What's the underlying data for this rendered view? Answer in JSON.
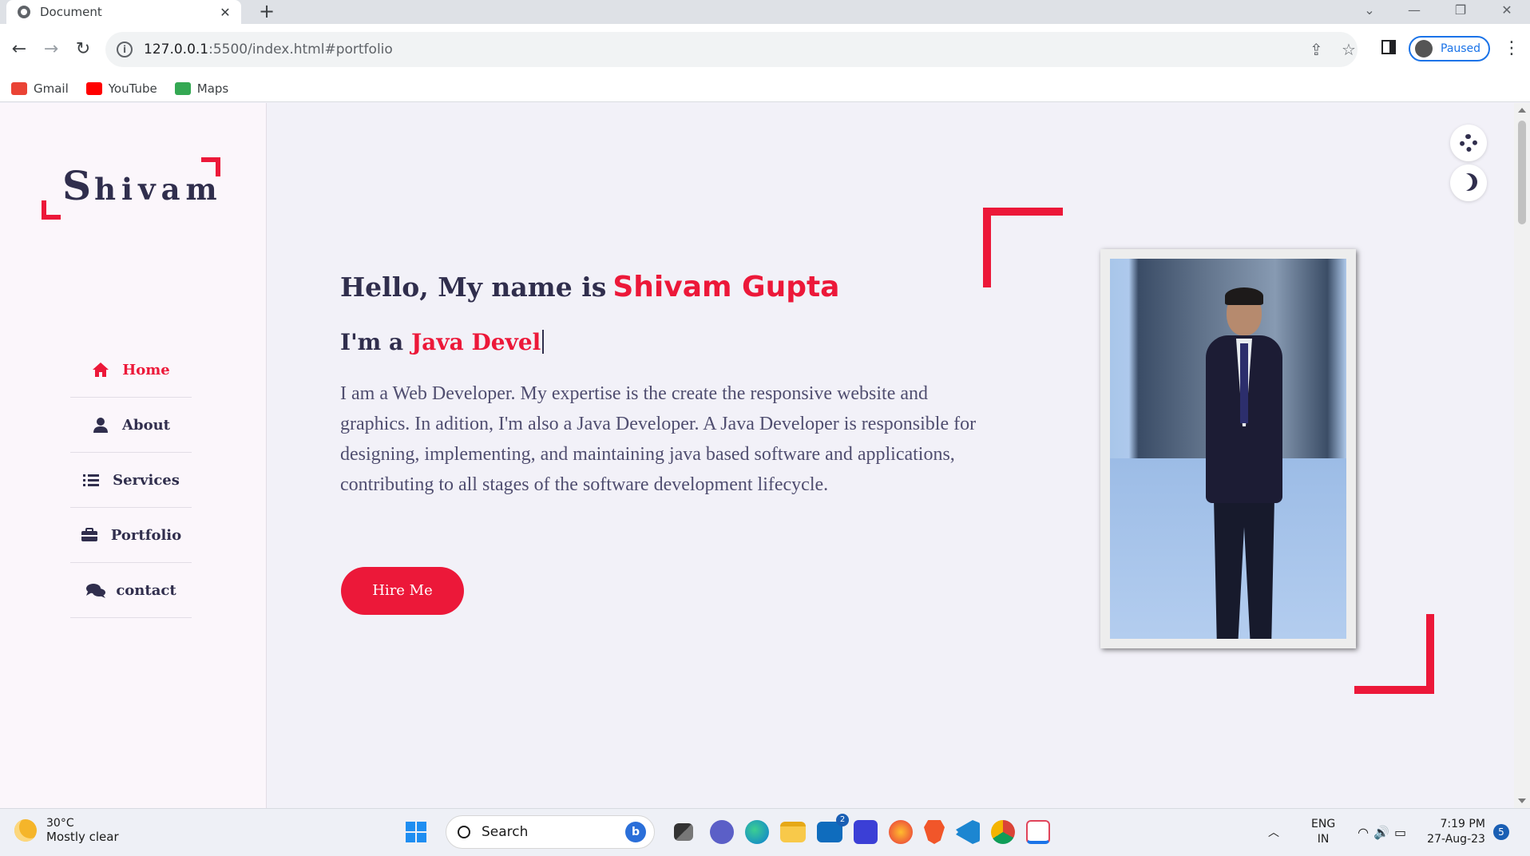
{
  "browser": {
    "tab_title": "Document",
    "tab_close": "✕",
    "new_tab": "+",
    "url_host": "127.0.0.1",
    "url_rest": ":5500/index.html#portfolio",
    "profile_status": "Paused",
    "bookmarks": [
      {
        "label": "Gmail",
        "color": "#ea4335"
      },
      {
        "label": "YouTube",
        "color": "#ff0000"
      },
      {
        "label": "Maps",
        "color": "#34a853"
      }
    ]
  },
  "site": {
    "logo_initial": "S",
    "logo_rest": "hivam",
    "nav": [
      {
        "label": "Home",
        "icon": "home-icon",
        "active": true
      },
      {
        "label": "About",
        "icon": "user-icon",
        "active": false
      },
      {
        "label": "Services",
        "icon": "list-icon",
        "active": false
      },
      {
        "label": "Portfolio",
        "icon": "briefcase-icon",
        "active": false
      },
      {
        "label": "contact",
        "icon": "comments-icon",
        "active": false
      }
    ],
    "hero": {
      "greeting": "Hello, My name is",
      "name": "Shivam Gupta",
      "role_prefix": "I'm a",
      "role_typed": "Java Devel",
      "bio": "I am a Web Developer. My expertise is the create the responsive website and graphics. In adition, I'm also a Java Developer. A Java Developer is responsible for designing, implementing, and maintaining java based software and applications, contributing to all stages of the software development lifecycle.",
      "cta": "Hire Me"
    },
    "accent_color": "#ec1839"
  },
  "taskbar": {
    "weather_temp": "30°C",
    "weather_desc": "Mostly clear",
    "search_placeholder": "Search",
    "lang_top": "ENG",
    "lang_bottom": "IN",
    "time": "7:19 PM",
    "date": "27-Aug-23",
    "notification_count": "5",
    "mail_badge": "2"
  }
}
